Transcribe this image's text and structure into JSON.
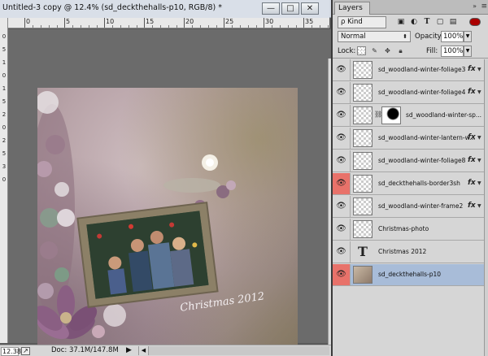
{
  "document": {
    "title": "Untitled-3 copy @ 12.4% (sd_deckthehalls-p10, RGB/8) *",
    "controls": {
      "minimize": "—",
      "maximize": "□",
      "close": "✕"
    },
    "ruler_top_labels": [
      "0",
      "5",
      "10",
      "15",
      "20",
      "25",
      "30",
      "35"
    ],
    "ruler_left_labels": [
      "0",
      "5",
      "1",
      "0",
      "1",
      "5",
      "2",
      "0",
      "2",
      "5",
      "3",
      "0"
    ],
    "artwork_text": "Christmas 2012"
  },
  "statusbar": {
    "zoom": "12.38%",
    "doc_size": "Doc: 37.1M/147.8M",
    "arrow": "▶"
  },
  "layers_panel": {
    "tab_label": "Layers",
    "collapse_icon": "»",
    "menu_icon": "≡",
    "filter": {
      "kind_label": "ρ Kind"
    },
    "blend_mode": "Normal",
    "opacity_label": "Opacity:",
    "opacity_value": "100%",
    "lock_label": "Lock:",
    "fill_label": "Fill:",
    "fill_value": "100%",
    "layers": [
      {
        "name": "sd_woodland-winter-foliage3",
        "fx": true,
        "eye_red": false,
        "thumb": "transparent",
        "selected": false
      },
      {
        "name": "sd_woodland-winter-foliage4",
        "fx": true,
        "eye_red": false,
        "thumb": "transparent",
        "selected": false
      },
      {
        "name": "sd_woodland-winter-sp...",
        "fx": false,
        "eye_red": false,
        "thumb": "mask",
        "selected": false
      },
      {
        "name": "sd_woodland-winter-lantern-w...",
        "fx": true,
        "eye_red": false,
        "thumb": "transparent",
        "selected": false
      },
      {
        "name": "sd_woodland-winter-foliage8",
        "fx": true,
        "eye_red": false,
        "thumb": "transparent",
        "selected": false
      },
      {
        "name": "sd_deckthehalls-border3sh",
        "fx": true,
        "eye_red": true,
        "thumb": "transparent",
        "selected": false
      },
      {
        "name": "sd_woodland-winter-frame2",
        "fx": true,
        "eye_red": false,
        "thumb": "transparent",
        "selected": false
      },
      {
        "name": "Christmas-photo",
        "fx": false,
        "eye_red": false,
        "thumb": "transparent",
        "selected": false
      },
      {
        "name": "Christmas 2012",
        "fx": false,
        "eye_red": false,
        "thumb": "text",
        "selected": false
      },
      {
        "name": "sd_deckthehalls-p10",
        "fx": false,
        "eye_red": true,
        "thumb": "paper",
        "selected": true
      }
    ],
    "fx_label": "fx"
  },
  "colors": {
    "selected_row": "#a8bcd8",
    "eye_highlight": "#e8726a",
    "panel_bg": "#d6d6d6",
    "workspace_bg": "#6b6b6b"
  }
}
